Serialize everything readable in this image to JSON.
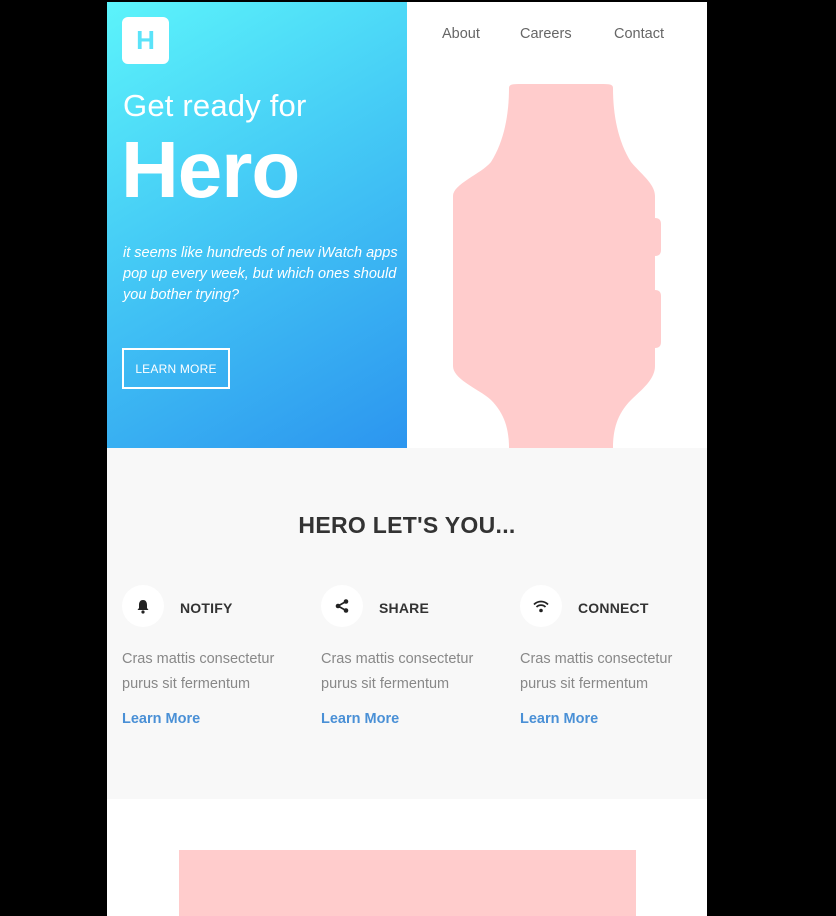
{
  "colors": {
    "hero_gradient_start": "#5cf4fb",
    "hero_gradient_end": "#2c95ef",
    "placeholder_pink": "#ffcccc",
    "link_blue": "#4a90d6",
    "section_bg": "#f8f8f8"
  },
  "header": {
    "logo_letter": "H",
    "nav": [
      "About",
      "Careers",
      "Contact"
    ]
  },
  "hero": {
    "eyebrow": "Get ready for",
    "title": "Hero",
    "lede": "it seems like hundreds of new iWatch apps pop up every week, but which ones should you bother trying?",
    "cta_label": "LEARN MORE",
    "image_icon": "smartwatch-silhouette"
  },
  "features": {
    "title": "HERO LET'S YOU...",
    "items": [
      {
        "icon": "bell-icon",
        "name": "NOTIFY",
        "desc": "Cras mattis consectetur purus sit fermentum",
        "link": "Learn More"
      },
      {
        "icon": "share-icon",
        "name": "SHARE",
        "desc": "Cras mattis consectetur purus sit fermentum",
        "link": "Learn More"
      },
      {
        "icon": "wifi-icon",
        "name": "CONNECT",
        "desc": "Cras mattis consectetur purus sit fermentum",
        "link": "Learn More"
      }
    ]
  }
}
